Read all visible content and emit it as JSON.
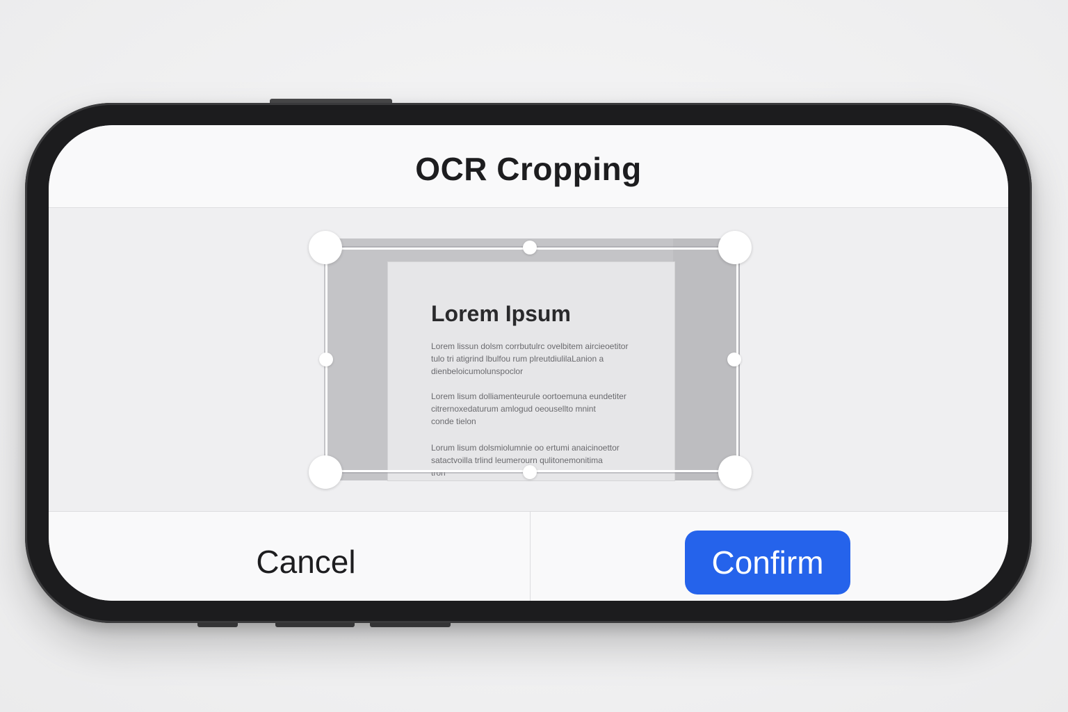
{
  "header": {
    "title": "OCR Cropping"
  },
  "document": {
    "title": "Lorem Ipsum",
    "paragraphs": [
      "Lorem lissun dolsm corrbutulrc ovelbitem aircieoetitor\ntulo  tri atigrind  lbulfou rum  plreutdiulilaLanion  a\ndienbeloicumolunspoclor",
      "Lorem lisum dolliamenteurule oortoemuna eundetiter\ncitrernoxedaturum  amlogud oeousellto mnint\nconde tielon",
      "Lorum lisum dolsmiolumnie oo ertumi anaicinoettor\nsatactvoilla trlind leumerourn qulitonemonitima\ntron"
    ]
  },
  "footer": {
    "cancel_label": "Cancel",
    "confirm_label": "Confirm"
  },
  "colors": {
    "accent": "#2563eb",
    "frame": "#1c1c1e"
  },
  "icons": {
    "crop_handle": "circle-handle"
  }
}
